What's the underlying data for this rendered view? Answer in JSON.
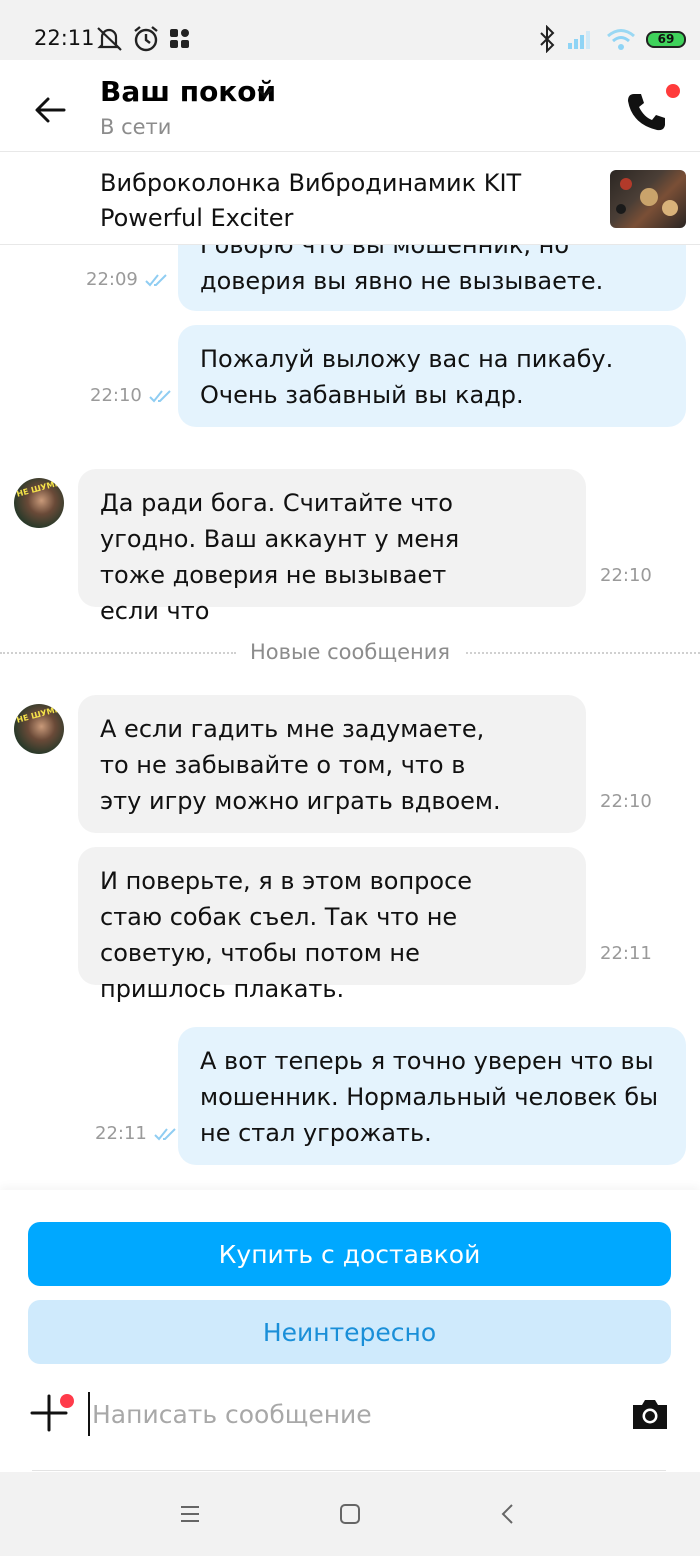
{
  "status_bar": {
    "time": "22:11",
    "battery": "69",
    "icons_left": [
      "mute-notifications-icon",
      "alarm-icon",
      "apps-grid-icon"
    ],
    "icons_right": [
      "bluetooth-icon",
      "signal-icon",
      "wifi-icon",
      "battery-icon"
    ]
  },
  "header": {
    "title": "Ваш покой",
    "status": "В сети",
    "call_has_notification": true
  },
  "item": {
    "title": "Виброколонка Вибродинамик KIT Powerful Exciter"
  },
  "messages": [
    {
      "direction": "out",
      "text": "Говорю что вы мошенник, но доверия вы явно не вызываете.",
      "time": "22:09",
      "read": true
    },
    {
      "direction": "out",
      "text": "Пожалуй выложу вас на пикабу. Очень забавный вы кадр.",
      "time": "22:10",
      "read": true
    },
    {
      "direction": "in",
      "text": "Да ради бога. Считайте что угодно. Ваш аккаунт у меня тоже доверия не вызывает если что",
      "time": "22:10"
    },
    {
      "direction": "in",
      "text": "А если гадить мне задумаете, то не забывайте о том, что в эту игру можно играть вдвоем.",
      "time": "22:10"
    },
    {
      "direction": "in",
      "text": "И поверьте, я в этом вопросе стаю собак съел. Так что не советую, чтобы потом не пришлось плакать.",
      "time": "22:11"
    },
    {
      "direction": "out",
      "text": "А вот теперь я точно уверен что вы мошенник. Нормальный человек бы не стал угрожать.",
      "time": "22:11",
      "read": true
    }
  ],
  "divider": {
    "label": "Новые сообщения"
  },
  "avatar_text": "НЕ ШУМИ",
  "actions": {
    "buy_label": "Купить с доставкой",
    "not_interested_label": "Неинтересно"
  },
  "composer": {
    "placeholder": "Написать сообщение",
    "value": ""
  },
  "colors": {
    "accent": "#00a8ff",
    "outgoing_bubble": "#e4f3fd",
    "incoming_bubble": "#f2f2f2",
    "secondary_button": "#cfeafc",
    "notification_dot": "#ff3b4a"
  }
}
